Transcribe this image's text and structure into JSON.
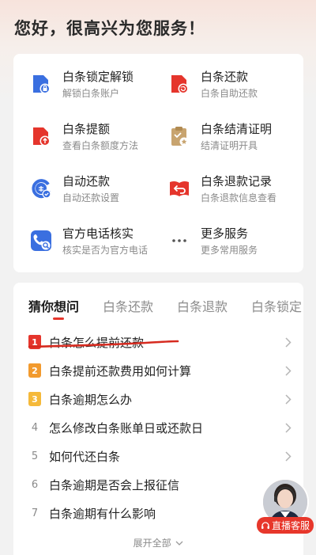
{
  "greeting": "您好，很高兴为您服务！",
  "services": [
    {
      "title": "白条锁定解锁",
      "subtitle": "解锁白条账户",
      "icon": "lock-card-icon"
    },
    {
      "title": "白条还款",
      "subtitle": "白条自助还款",
      "icon": "repay-card-icon"
    },
    {
      "title": "白条提额",
      "subtitle": "查看白条额度方法",
      "icon": "raise-limit-icon"
    },
    {
      "title": "白条结清证明",
      "subtitle": "结清证明开具",
      "icon": "clipboard-certificate-icon"
    },
    {
      "title": "自动还款",
      "subtitle": "自动还款设置",
      "icon": "auto-repay-icon"
    },
    {
      "title": "白条退款记录",
      "subtitle": "白条退款信息查看",
      "icon": "refund-book-icon"
    },
    {
      "title": "官方电话核实",
      "subtitle": "核实是否为官方电话",
      "icon": "phone-verify-icon"
    },
    {
      "title": "更多服务",
      "subtitle": "更多常用服务",
      "icon": "more-dots-icon"
    }
  ],
  "tabs": [
    "猜你想问",
    "白条还款",
    "白条退款",
    "白条锁定"
  ],
  "questions": [
    {
      "num": "1",
      "text": "白条怎么提前还款",
      "badge": "#e5352c"
    },
    {
      "num": "2",
      "text": "白条提前还款费用如何计算",
      "badge": "#f29a2e"
    },
    {
      "num": "3",
      "text": "白条逾期怎么办",
      "badge": "#f5b93a"
    },
    {
      "num": "4",
      "text": "怎么修改白条账单日或还款日",
      "badge": ""
    },
    {
      "num": "5",
      "text": "如何代还白条",
      "badge": ""
    },
    {
      "num": "6",
      "text": "白条逾期是否会上报征信",
      "badge": ""
    },
    {
      "num": "7",
      "text": "白条逾期有什么影响",
      "badge": ""
    }
  ],
  "expand_label": "展开全部",
  "live_service_label": "直播客服",
  "colors": {
    "accent": "#e5352c",
    "blue": "#3a6fe0",
    "tan": "#c8a46f"
  }
}
